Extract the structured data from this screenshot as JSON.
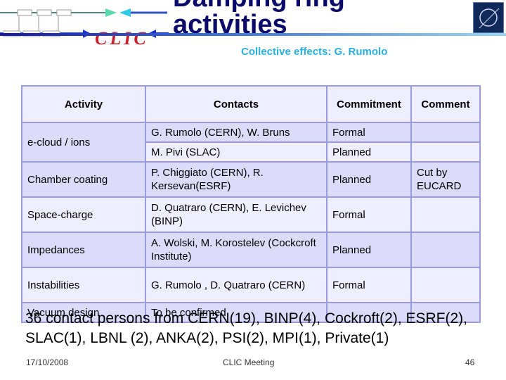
{
  "header": {
    "title_line1": "Damping ring",
    "title_line2": "activities",
    "subtitle": "Collective effects: G. Rumolo",
    "logo_left_text": "CLIC",
    "logo_right": "cern-logo-icon"
  },
  "table": {
    "headers": [
      "Activity",
      "Contacts",
      "Commitment",
      "Comment"
    ],
    "rows": [
      {
        "activity": "e-cloud / ions",
        "contact": "G. Rumolo (CERN), W. Bruns",
        "commitment": "Formal",
        "comment": ""
      },
      {
        "activity": "",
        "contact": "M. Pivi (SLAC)",
        "commitment": "Planned",
        "comment": ""
      },
      {
        "activity": "Chamber coating",
        "contact": "P. Chiggiato (CERN), R. Kersevan(ESRF)",
        "commitment": "Planned",
        "comment": "Cut by EUCARD"
      },
      {
        "activity": "Space-charge",
        "contact": "D. Quatraro (CERN), E. Levichev (BINP)",
        "commitment": "Formal",
        "comment": ""
      },
      {
        "activity": "Impedances",
        "contact": "A. Wolski, M. Korostelev (Cockcroft Institute)",
        "commitment": "Planned",
        "comment": ""
      },
      {
        "activity": "Instabilities",
        "contact": "G. Rumolo , D. Quatraro (CERN)",
        "commitment": "Formal",
        "comment": ""
      },
      {
        "activity": "Vacuum design",
        "contact": "To be confirmed",
        "commitment": "",
        "comment": ""
      }
    ]
  },
  "summary": "36 contact persons from CERN(19), BINP(4), Cockroft(2), ESRF(2), SLAC(1), LBNL (2), ANKA(2), PSI(2), MPI(1), Private(1)",
  "footer": {
    "date": "17/10/2008",
    "center": "CLIC Meeting",
    "page": "46"
  }
}
